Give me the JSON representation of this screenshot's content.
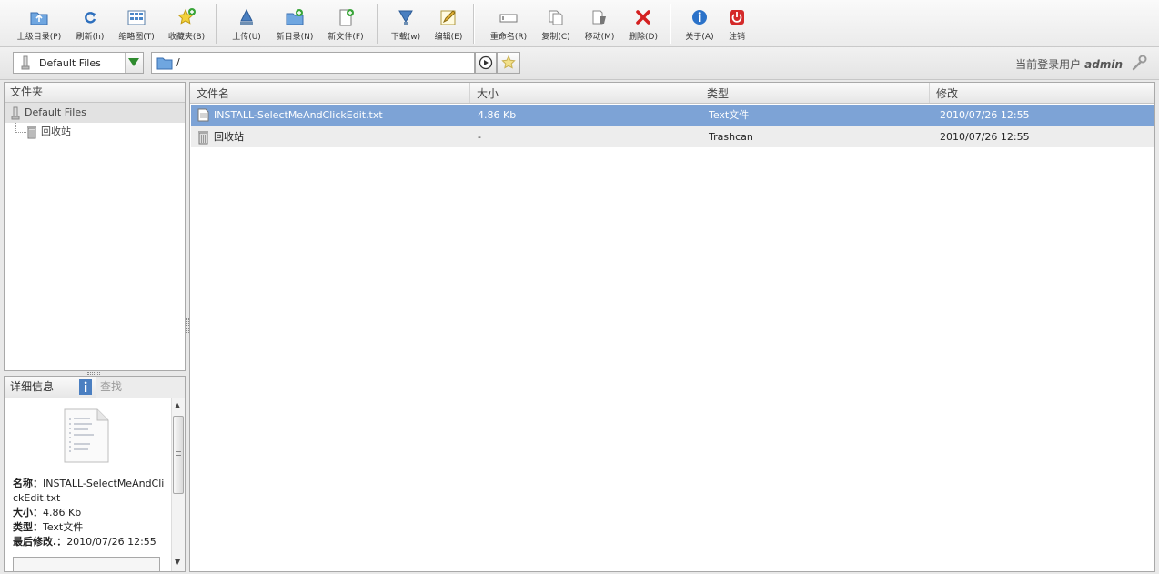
{
  "toolbar": {
    "buttons": [
      {
        "label": "上级目录(P)",
        "icon": "parent-folder-icon"
      },
      {
        "label": "刷新(h)",
        "icon": "refresh-icon"
      },
      {
        "label": "缩略图(T)",
        "icon": "thumbnails-icon"
      },
      {
        "label": "收藏夹(B)",
        "icon": "favorites-star-icon"
      },
      {
        "label": "上传(U)",
        "icon": "upload-icon"
      },
      {
        "label": "新目录(N)",
        "icon": "new-folder-icon"
      },
      {
        "label": "新文件(F)",
        "icon": "new-file-icon"
      },
      {
        "label": "下载(w)",
        "icon": "download-icon"
      },
      {
        "label": "编辑(E)",
        "icon": "edit-icon"
      },
      {
        "label": "重命名(R)",
        "icon": "rename-icon"
      },
      {
        "label": "复制(C)",
        "icon": "copy-icon"
      },
      {
        "label": "移动(M)",
        "icon": "move-icon"
      },
      {
        "label": "删除(D)",
        "icon": "delete-icon"
      },
      {
        "label": "关于(A)",
        "icon": "info-icon"
      },
      {
        "label": "注销",
        "icon": "logout-power-icon"
      }
    ]
  },
  "addressbar": {
    "source": "Default Files",
    "path": "/",
    "user_label": "当前登录用户",
    "username": "admin"
  },
  "folders": {
    "title": "文件夹",
    "root": "Default Files",
    "children": [
      "回收站"
    ]
  },
  "details": {
    "tab_details": "详细信息",
    "tab_search": "查找",
    "name_label": "名称：",
    "name_value": "INSTALL-SelectMeAndClickEdit.txt",
    "size_label": "大小：",
    "size_value": "4.86 Kb",
    "type_label": "类型：",
    "type_value": "Text文件",
    "modified_label": "最后修改.：",
    "modified_value": "2010/07/26 12:55"
  },
  "grid": {
    "columns": [
      "文件名",
      "大小",
      "类型",
      "修改"
    ],
    "rows": [
      {
        "name": "INSTALL-SelectMeAndClickEdit.txt",
        "size": "4.86 Kb",
        "type": "Text文件",
        "modified": "2010/07/26 12:55",
        "icon": "text-file-icon",
        "selected": true
      },
      {
        "name": "回收站",
        "size": "-",
        "type": "Trashcan",
        "modified": "2010/07/26 12:55",
        "icon": "trashcan-icon",
        "selected": false
      }
    ]
  },
  "colors": {
    "selection": "#7da3d6",
    "toolbar_icon_blue": "#3b7fc4",
    "delete_red": "#d42020"
  }
}
